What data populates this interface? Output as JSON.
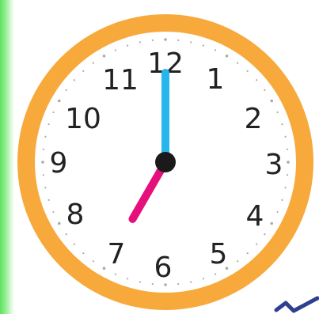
{
  "clock": {
    "numerals": [
      "12",
      "1",
      "2",
      "3",
      "4",
      "5",
      "6",
      "7",
      "8",
      "9",
      "10",
      "11"
    ],
    "time": {
      "hour": 7,
      "minute": 0
    },
    "colors": {
      "rim": "#f7a93b",
      "face": "#ffffff",
      "minute_hand": "#26b5ec",
      "hour_hand": "#e6107c",
      "pivot": "#1a1a1a",
      "numerals": "#222222",
      "ticks": "#aaaaaa"
    },
    "icons": [
      "green-edge-decoration",
      "checkmark-icon"
    ]
  }
}
